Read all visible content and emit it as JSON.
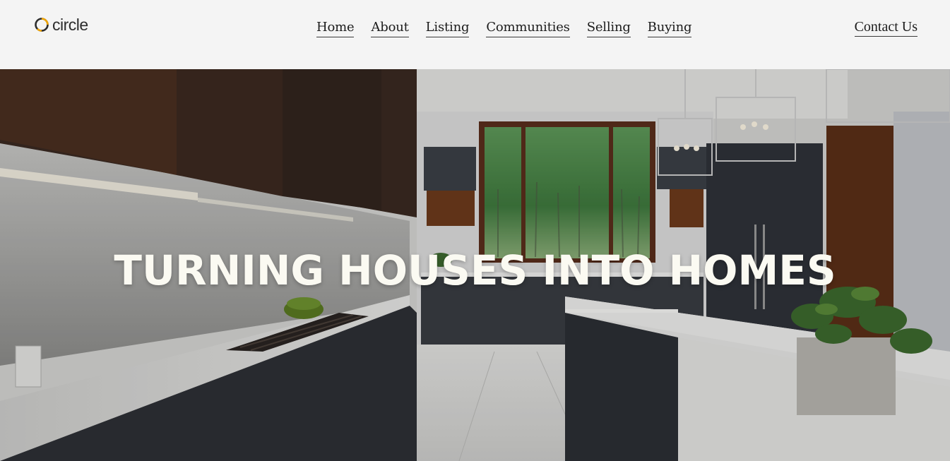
{
  "brand": {
    "name": "circle",
    "accent_color": "#f0a400",
    "text_color": "#2d2d2d"
  },
  "nav": {
    "items": [
      {
        "label": "Home"
      },
      {
        "label": "About"
      },
      {
        "label": "Listing"
      },
      {
        "label": "Communities"
      },
      {
        "label": "Selling"
      },
      {
        "label": "Buying"
      }
    ],
    "contact_label": "Contact Us"
  },
  "hero": {
    "title": "TURNING HOUSES INTO HOMES",
    "image_description_icon": "kitchen-photo",
    "title_color": "#fbfaf2"
  },
  "colors": {
    "header_bg": "#f4f4f4",
    "link_color": "#1c1c1c"
  }
}
